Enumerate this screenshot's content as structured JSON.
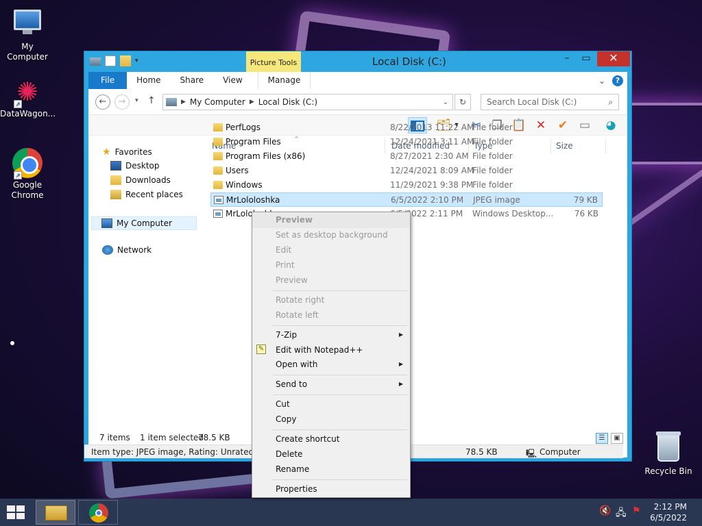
{
  "desktop": {
    "icons": [
      {
        "label": "My Computer"
      },
      {
        "label": "DataWagon..."
      },
      {
        "label": "Google Chrome"
      },
      {
        "label": "Recycle Bin"
      }
    ]
  },
  "window": {
    "title": "Local Disk (C:)",
    "contextual_tab_group": "Picture Tools",
    "ribbon_tabs": [
      "File",
      "Home",
      "Share",
      "View",
      "Manage"
    ],
    "help_label": "?",
    "address": {
      "segments": [
        "My Computer",
        "Local Disk (C:)"
      ]
    },
    "search": {
      "placeholder": "Search Local Disk (C:)"
    },
    "nav": {
      "favorites": "Favorites",
      "favorite_items": [
        "Desktop",
        "Downloads",
        "Recent places"
      ],
      "computer": "My Computer",
      "network": "Network"
    },
    "columns": {
      "name": "Name",
      "date": "Date modified",
      "type": "Type",
      "size": "Size"
    },
    "files": [
      {
        "name": "PerfLogs",
        "date": "8/22/2013 11:22 AM",
        "type": "File folder",
        "size": "",
        "kind": "folder"
      },
      {
        "name": "Program Files",
        "date": "12/24/2021 3:11 AM",
        "type": "File folder",
        "size": "",
        "kind": "folder"
      },
      {
        "name": "Program Files (x86)",
        "date": "8/27/2021 2:30 AM",
        "type": "File folder",
        "size": "",
        "kind": "folder"
      },
      {
        "name": "Users",
        "date": "12/24/2021 8:09 AM",
        "type": "File folder",
        "size": "",
        "kind": "folder"
      },
      {
        "name": "Windows",
        "date": "11/29/2021 9:38 PM",
        "type": "File folder",
        "size": "",
        "kind": "folder"
      },
      {
        "name": "MrLololoshka",
        "date": "6/5/2022 2:10 PM",
        "type": "JPEG image",
        "size": "79 KB",
        "kind": "jpg",
        "selected": true
      },
      {
        "name": "MrLololoshka",
        "date": "6/5/2022 2:11 PM",
        "type": "Windows Desktop...",
        "size": "76 KB",
        "kind": "theme"
      }
    ],
    "status": {
      "items": "7 items",
      "selected": "1 item selected",
      "selected_size": "78.5 KB"
    },
    "infobar": {
      "text": "Item type: JPEG image, Rating: Unrated, Dime",
      "size": "78.5 KB",
      "location": "Computer"
    }
  },
  "context_menu": {
    "items": [
      {
        "label": "Preview",
        "disabled": true,
        "bold": true
      },
      {
        "label": "Set as desktop background",
        "disabled": true
      },
      {
        "label": "Edit",
        "disabled": true
      },
      {
        "label": "Print",
        "disabled": true
      },
      {
        "label": "Preview",
        "disabled": true
      },
      {
        "label": "Rotate right",
        "disabled": true
      },
      {
        "label": "Rotate left",
        "disabled": true
      },
      {
        "label": "7-Zip",
        "submenu": true
      },
      {
        "label": "Edit with Notepad++"
      },
      {
        "label": "Open with",
        "submenu": true
      },
      {
        "label": "Send to",
        "submenu": true
      },
      {
        "label": "Cut"
      },
      {
        "label": "Copy"
      },
      {
        "label": "Create shortcut"
      },
      {
        "label": "Delete"
      },
      {
        "label": "Rename"
      },
      {
        "label": "Properties"
      }
    ]
  },
  "taskbar": {
    "clock_time": "2:12 PM",
    "clock_date": "6/5/2022"
  }
}
